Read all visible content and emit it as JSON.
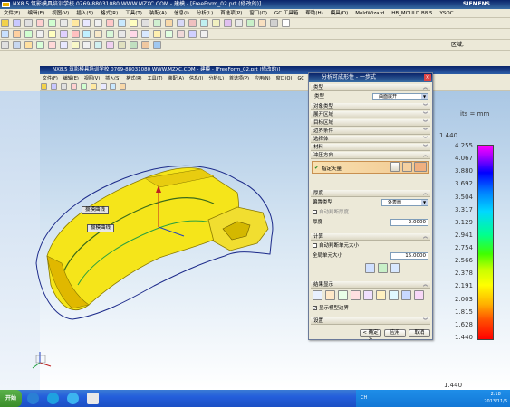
{
  "app": {
    "title": "NX8.5   筑影模具培训学校   0769-88031080   WWW.MZXC.COM - 建模 - [FreeForm_02.prt (修改的)]",
    "brand": "SIEMENS",
    "inner_title": "NX8.5   筑影模具培训学校   0769-88031080   WWW.MZXC.COM - 建模 - [FreeForm_02.prt (修改的)]"
  },
  "menu": {
    "items": [
      "文件(F)",
      "编辑(E)",
      "视图(V)",
      "插入(S)",
      "格式(R)",
      "工具(T)",
      "装配(A)",
      "信息(I)",
      "分析(L)",
      "首选项(P)",
      "窗口(O)",
      "GC 工具箱",
      "帮助(H)",
      "模具(D)",
      "MoldWizard",
      "HB_MOULD B8.5",
      "YSOC"
    ]
  },
  "inner_menu": {
    "items": [
      "文件(F)",
      "编辑(E)",
      "视图(V)",
      "插入(S)",
      "格式(R)",
      "工具(T)",
      "装配(A)",
      "信息(I)",
      "分析(L)",
      "首选项(P)",
      "应用(N)",
      "窗口(O)",
      "GC"
    ]
  },
  "toolbar": {
    "area_label": "区域,"
  },
  "legend": {
    "units_label": "its = mm",
    "top_value": "1.440",
    "bottom_value": "1.440",
    "values": [
      "4.255",
      "4.067",
      "3.880",
      "3.692",
      "3.504",
      "3.317",
      "3.129",
      "2.941",
      "2.754",
      "2.566",
      "2.378",
      "2.191",
      "2.003",
      "1.815",
      "1.628",
      "1.440"
    ]
  },
  "callouts": {
    "a": "拔模曲线",
    "b": "拔模曲线"
  },
  "dialog": {
    "title": "分析可成形性 - 一步式",
    "sections": {
      "type": "类型",
      "object_type": "对象类型",
      "unfold_region": "展开区域",
      "target_region": "目标区域",
      "boundary": "边界条件",
      "add_body": "选择体",
      "material": "材料",
      "stamp_direction": "冲压方向",
      "thickness": "厚度",
      "calculate": "计算",
      "result": "结果显示",
      "settings": "设置"
    },
    "type_value": "曲面展开",
    "specify_vector": "指定矢量",
    "thickness_type_label": "偏置类型",
    "thickness_type_value": "外表面",
    "use_default_thickness": "自动判断厚度",
    "thickness_label": "厚度",
    "thickness_value": "2.0000",
    "auto_mesh": "自动判断单元大小",
    "mesh_size_label": "全局单元大小",
    "mesh_size_value": "15.0000",
    "show_boundary": "显示模型边界",
    "ok": "< 确定 >",
    "apply": "应用",
    "cancel": "取消"
  },
  "taskbar": {
    "start": "开始",
    "time": "2:18",
    "date": "2013/11/6",
    "lang": "CH"
  },
  "colors": {
    "title_blue": "#0a246a",
    "part_yellow": "#f5e51a",
    "dialog_bg": "#ece9d8"
  }
}
